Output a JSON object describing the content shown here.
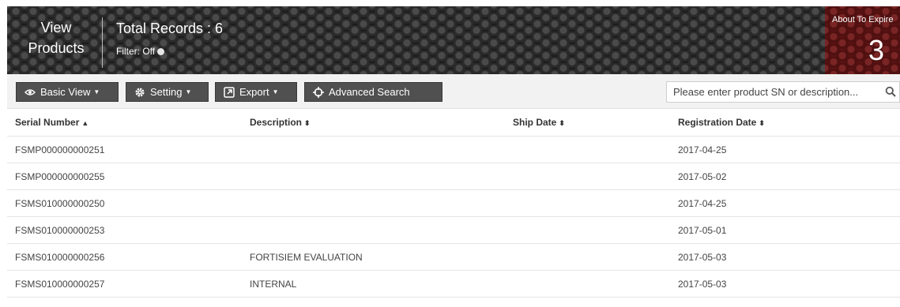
{
  "header": {
    "title_line1": "View",
    "title_line2": "Products",
    "records_label": "Total Records : 6",
    "filter_label": "Filter: Off",
    "expire_label": "About To Expire",
    "expire_count": "3"
  },
  "toolbar": {
    "basic_view": "Basic View",
    "setting": "Setting",
    "export": "Export",
    "advanced_search": "Advanced Search",
    "search_placeholder": "Please enter product SN or description...",
    "search_value": ""
  },
  "table": {
    "columns": [
      {
        "label": "Serial Number",
        "sort": "▲"
      },
      {
        "label": "Description",
        "sort": "⬍"
      },
      {
        "label": "Ship Date",
        "sort": "⬍"
      },
      {
        "label": "Registration Date",
        "sort": "⬍"
      }
    ],
    "rows": [
      {
        "serial": "FSMP000000000251",
        "description": "",
        "ship_date": "",
        "registration_date": "2017-04-25"
      },
      {
        "serial": "FSMP000000000255",
        "description": "",
        "ship_date": "",
        "registration_date": "2017-05-02"
      },
      {
        "serial": "FSMS010000000250",
        "description": "",
        "ship_date": "",
        "registration_date": "2017-04-25"
      },
      {
        "serial": "FSMS010000000253",
        "description": "",
        "ship_date": "",
        "registration_date": "2017-05-01"
      },
      {
        "serial": "FSMS010000000256",
        "description": "FORTISIEM EVALUATION",
        "ship_date": "",
        "registration_date": "2017-05-03"
      },
      {
        "serial": "FSMS010000000257",
        "description": "INTERNAL",
        "ship_date": "",
        "registration_date": "2017-05-03"
      }
    ]
  },
  "icons": {
    "basic_view": "eye-icon",
    "setting": "gear-icon",
    "export": "export-icon",
    "advanced_search": "crosshair-icon",
    "search": "search-icon"
  },
  "colors": {
    "header_bg": "#1c1c1c",
    "expire_bg": "#5a1212",
    "button_bg": "#505050"
  }
}
